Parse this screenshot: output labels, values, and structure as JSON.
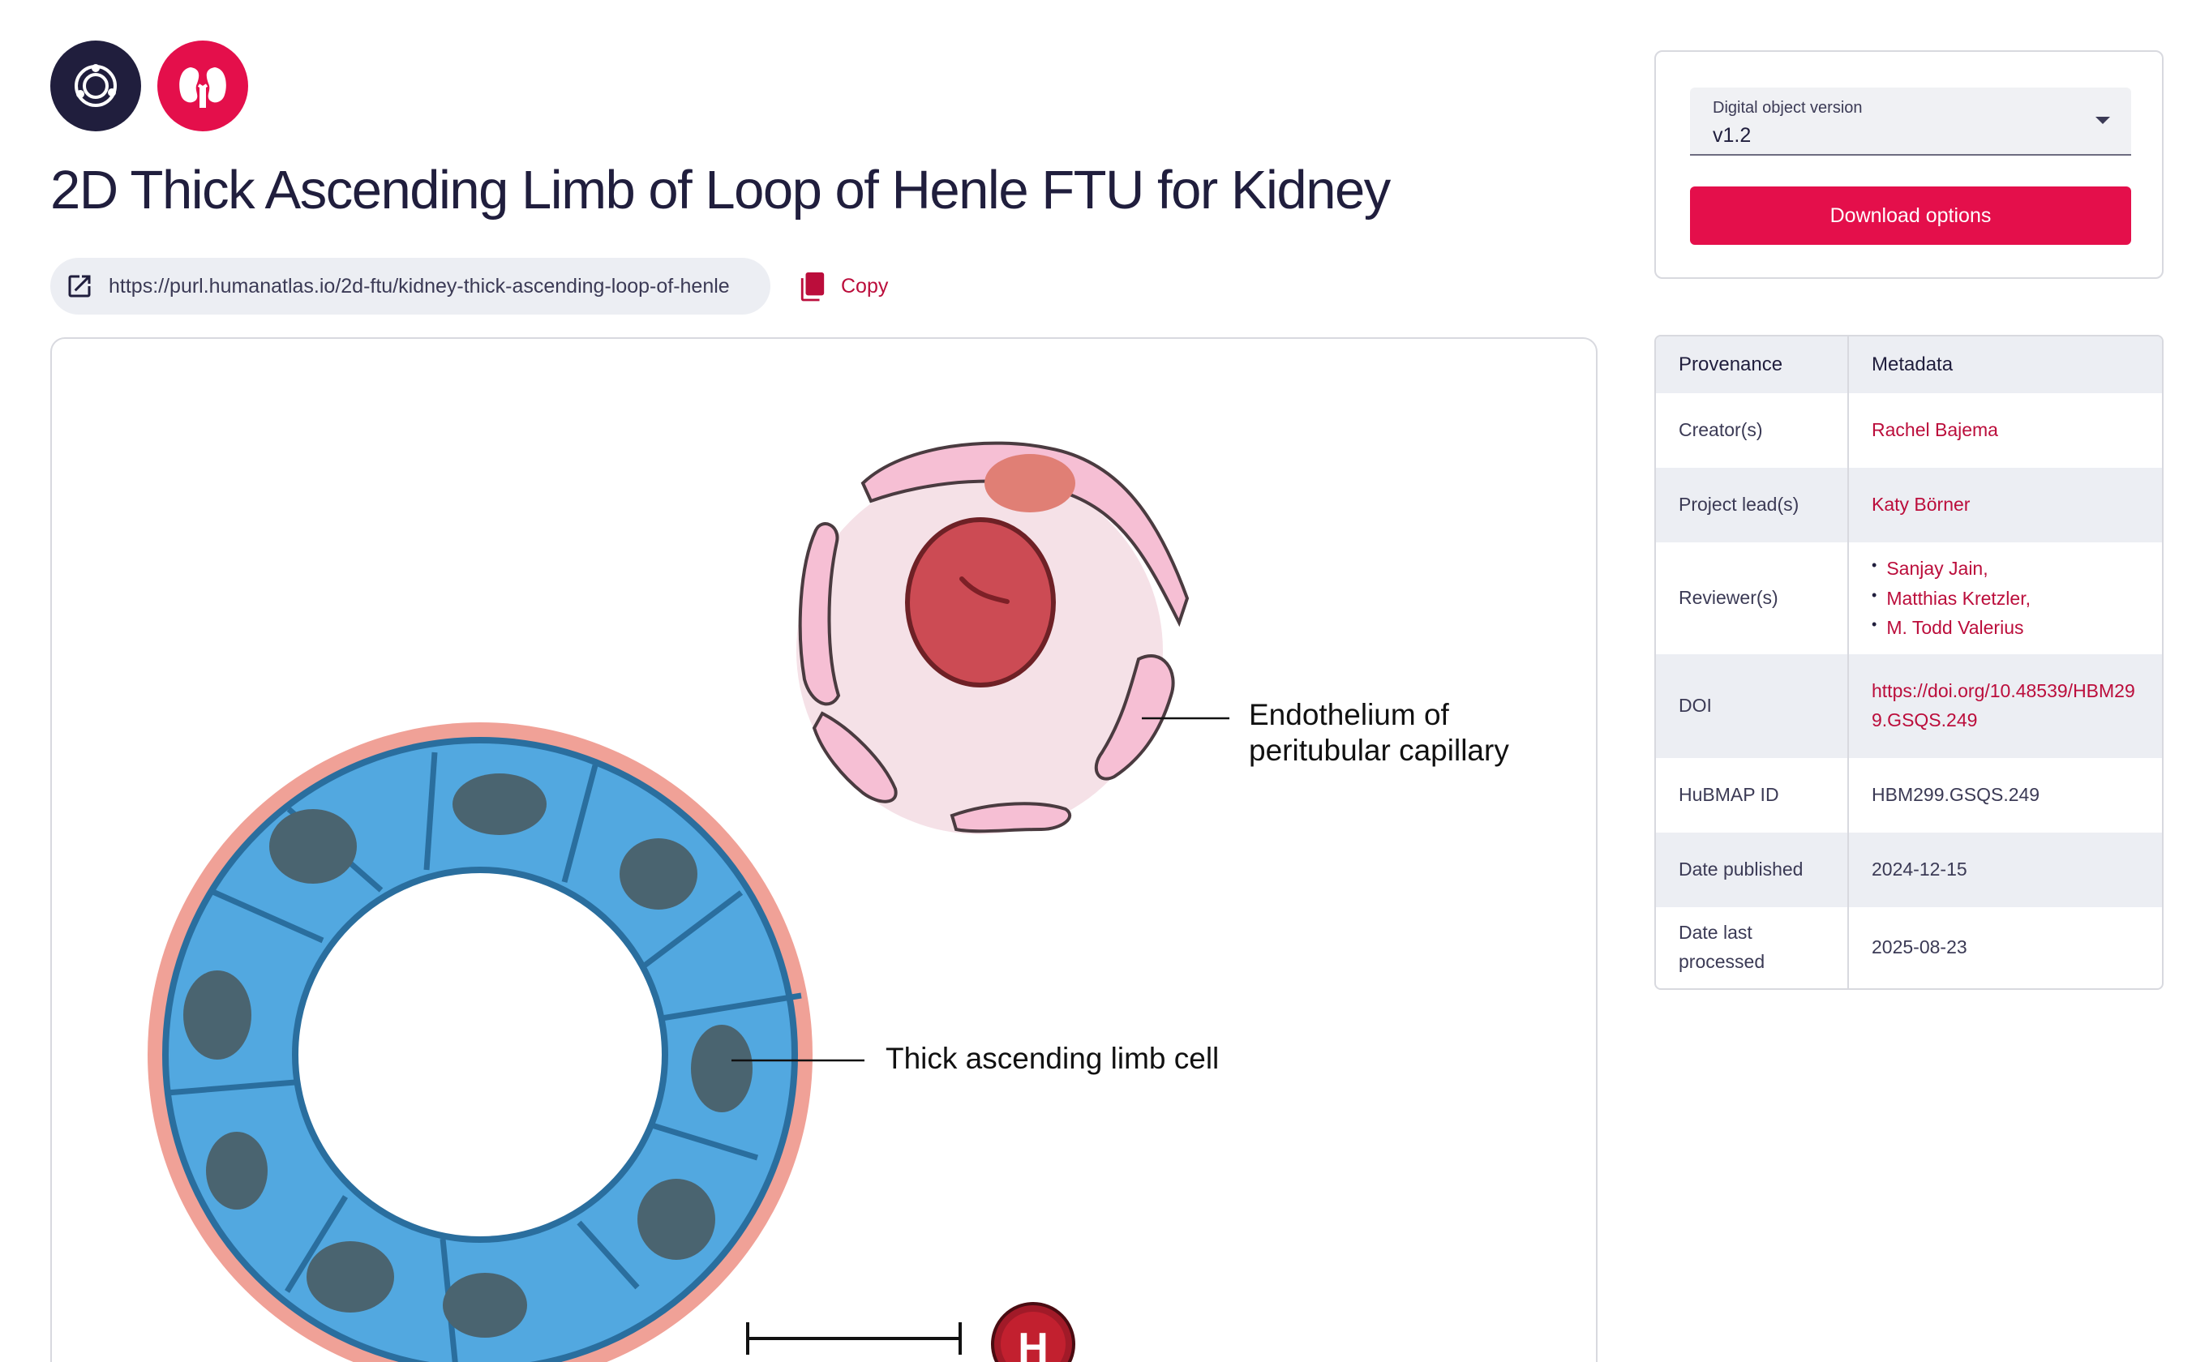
{
  "header": {
    "title": "2D Thick Ascending Limb of Loop of Henle FTU for Kidney",
    "purl": "https://purl.humanatlas.io/2d-ftu/kidney-thick-ascending-loop-of-henle",
    "copy_label": "Copy",
    "logos": [
      "hra-logo-icon",
      "kidney-icon"
    ]
  },
  "version_card": {
    "select_label": "Digital object version",
    "select_value": "v1.2",
    "download_label": "Download options"
  },
  "metadata": {
    "headers": [
      "Provenance",
      "Metadata"
    ],
    "creators_key": "Creator(s)",
    "creators": "Rachel Bajema",
    "leads_key": "Project lead(s)",
    "leads": "Katy Börner",
    "reviewers_key": "Reviewer(s)",
    "reviewers": [
      "Sanjay Jain,",
      "Matthias Kretzler,",
      "M. Todd Valerius"
    ],
    "doi_key": "DOI",
    "doi": "https://doi.org/10.48539/HBM299.GSQS.249",
    "hubmap_key": "HuBMAP ID",
    "hubmap": "HBM299.GSQS.249",
    "published_key": "Date published",
    "published": "2024-12-15",
    "processed_key": "Date last processed",
    "processed": "2025-08-23"
  },
  "illustration": {
    "label_endothelium": "Endothelium of peritubular capillary",
    "label_cell": "Thick ascending limb cell",
    "badge_letter": "H"
  },
  "colors": {
    "accent": "#e40f4b",
    "link": "#bb0d3b",
    "navy": "#201e3d",
    "cell_blue": "#52a8e0",
    "nucleus": "#4a6470",
    "basement": "#f0a197"
  }
}
